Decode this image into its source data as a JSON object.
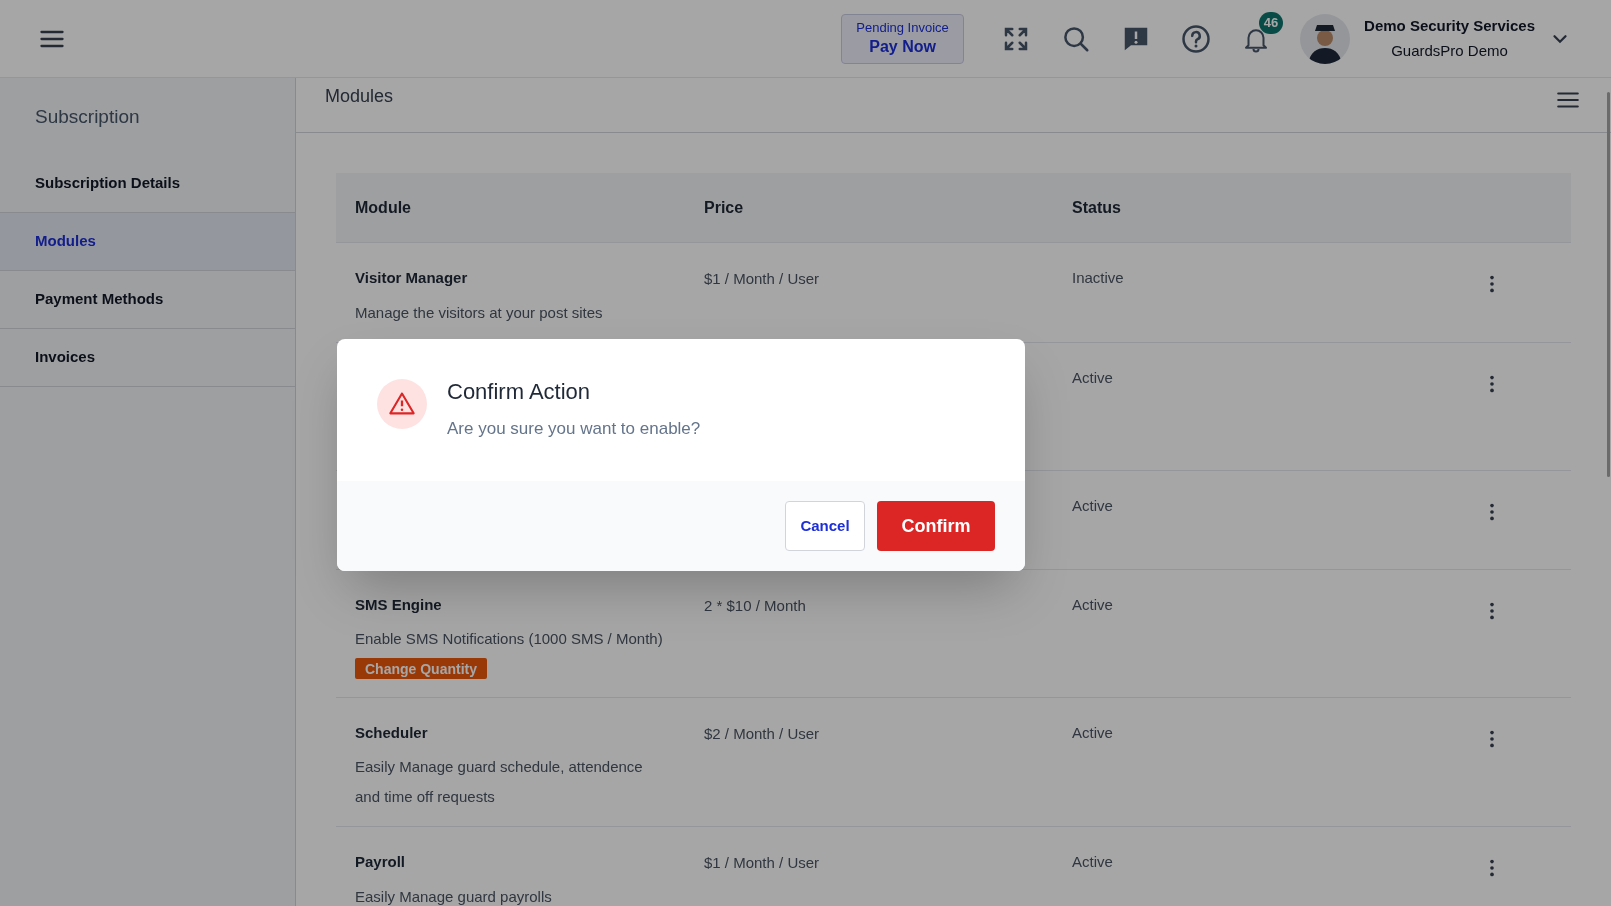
{
  "header": {
    "invoice": {
      "label": "Pending Invoice",
      "action": "Pay Now"
    },
    "notifications": {
      "count": "46"
    },
    "user": {
      "company": "Demo Security Services",
      "account": "GuardsPro Demo"
    }
  },
  "sidebar": {
    "title": "Subscription",
    "items": [
      {
        "label": "Subscription Details",
        "selected": false
      },
      {
        "label": "Modules",
        "selected": true
      },
      {
        "label": "Payment Methods",
        "selected": false
      },
      {
        "label": "Invoices",
        "selected": false
      }
    ]
  },
  "page": {
    "title": "Modules"
  },
  "table": {
    "columns": [
      "Module",
      "Price",
      "Status"
    ],
    "rows": [
      {
        "name": "Visitor Manager",
        "description": "Manage the visitors at your post sites",
        "price": "$1 / Month / User",
        "status_text": "Inactive"
      },
      {
        "status_text": "Active"
      },
      {
        "status_text": "Active"
      },
      {
        "name": "SMS Engine",
        "description": "Enable SMS Notifications (1000 SMS / Month)",
        "price": "2 * $10 / Month",
        "status_text": "Active",
        "action": "Change Quantity"
      },
      {
        "name": "Scheduler",
        "description": "Easily Manage guard schedule, attendence and time off requests",
        "price": "$2 / Month / User",
        "status_text": "Active"
      },
      {
        "name": "Payroll",
        "description": "Easily Manage guard payrolls",
        "price": "$1 / Month / User",
        "status_text": "Active"
      }
    ]
  },
  "dialog": {
    "title": "Confirm Action",
    "message": "Are you sure you want to enable?",
    "buttons": [
      {
        "kind": "secondary",
        "label": "Cancel"
      },
      {
        "kind": "primary",
        "label": "Confirm"
      }
    ]
  }
}
